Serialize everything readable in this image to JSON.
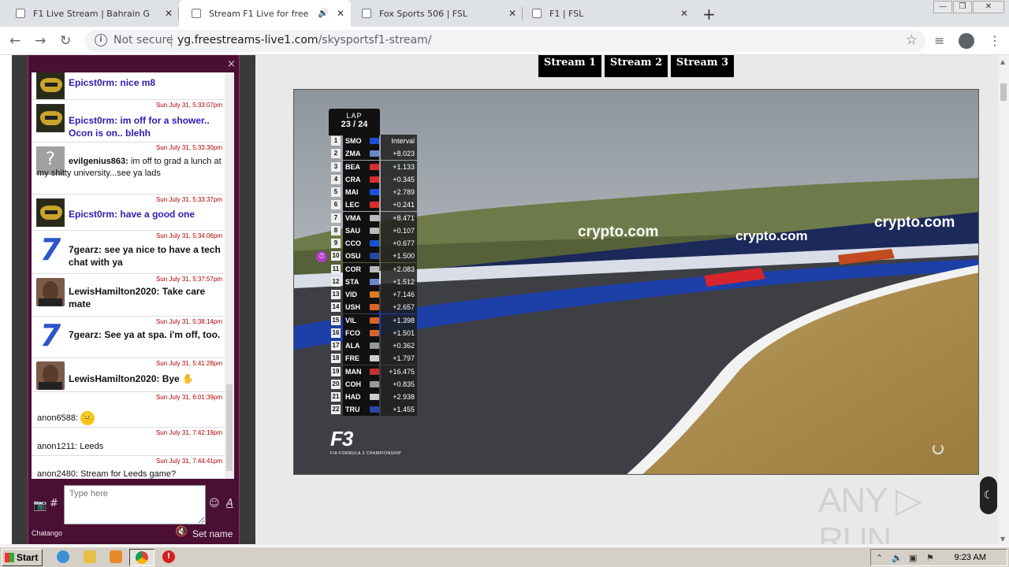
{
  "browser": {
    "tabs": [
      {
        "title": "F1 Live Stream | Bahrain GP Stre",
        "active": false
      },
      {
        "title": "Stream F1 Live for free on",
        "active": true
      },
      {
        "title": "Fox Sports 506 | FSL",
        "active": false
      },
      {
        "title": "F1 | FSL",
        "active": false
      }
    ],
    "tab_close": "✕",
    "new_tab": "+",
    "security": "Not secure",
    "url_host": "yg.freestreams-live1.com",
    "url_path": "/skysportsf1-stream/"
  },
  "chat": {
    "close": "×",
    "messages": [
      {
        "user": "Epicst0rm:",
        "text": "nice m8",
        "time": "",
        "avatar": "helmet"
      },
      {
        "user": "Epicst0rm:",
        "text": "im off for a shower.. Ocon is on.. blehh",
        "time": "Sun July 31, 5:33:07pm",
        "avatar": "helmet"
      },
      {
        "user": "evilgenius863:",
        "text": "im off to grad a lunch at my shitty university...see ya lads",
        "time": "Sun July 31, 5:33:30pm",
        "avatar": "question"
      },
      {
        "user": "Epicst0rm:",
        "text": "have a good one",
        "time": "Sun July 31, 5:33:37pm",
        "avatar": "helmet"
      },
      {
        "user": "7gearz:",
        "text": "see ya nice to have a tech chat with ya",
        "time": "Sun July 31, 5:34:06pm",
        "avatar": "seven"
      },
      {
        "user": "LewisHamilton2020:",
        "text": "Take care mate",
        "time": "Sun July 31, 5:37:57pm",
        "avatar": "lh"
      },
      {
        "user": "7gearz:",
        "text": "See ya at spa. i'm off, too.",
        "time": "Sun July 31, 5:38:14pm",
        "avatar": "seven"
      },
      {
        "user": "LewisHamilton2020:",
        "text": "Bye",
        "time": "Sun July 31, 5:41:28pm",
        "avatar": "lh"
      },
      {
        "user": "anon6588:",
        "text": "",
        "time": "Sun July 31, 6:01:39pm",
        "avatar": ""
      },
      {
        "user": "anon1211:",
        "text": "Leeds",
        "time": "Sun July 31, 7:42:19pm",
        "avatar": ""
      },
      {
        "user": "anon2480:",
        "text": "Stream for Leeds game?",
        "time": "Sun July 31, 7:44:41pm",
        "avatar": ""
      }
    ],
    "input_placeholder": "Type here",
    "hash": "#",
    "brand": "Chatango",
    "set_name": "Set name"
  },
  "streams": [
    "Stream 1",
    "Stream 2",
    "Stream 3"
  ],
  "video": {
    "lap_label": "LAP",
    "lap_value": "23 / 24",
    "interval_label": "Interval",
    "series": "F3",
    "series_sub": "FIA FORMULA 3 CHAMPIONSHIP",
    "banner": "crypto.com",
    "standings": [
      {
        "pos": "1",
        "driver": "SMO",
        "gap": "Interval",
        "team_color": "#1b4fd6"
      },
      {
        "pos": "2",
        "driver": "ZMA",
        "gap": "+8.023",
        "team_color": "#6d86c9"
      },
      {
        "pos": "3",
        "driver": "BEA",
        "gap": "+1.133",
        "team_color": "#d92d2d"
      },
      {
        "pos": "4",
        "driver": "CRA",
        "gap": "+0.345",
        "team_color": "#d92d2d"
      },
      {
        "pos": "5",
        "driver": "MAI",
        "gap": "+2.789",
        "team_color": "#1b4fd6"
      },
      {
        "pos": "6",
        "driver": "LEC",
        "gap": "+0.241",
        "team_color": "#d92d2d"
      },
      {
        "pos": "7",
        "driver": "VMA",
        "gap": "+8.471",
        "team_color": "#bbbbbb"
      },
      {
        "pos": "8",
        "driver": "SAU",
        "gap": "+0.107",
        "team_color": "#bbbbbb"
      },
      {
        "pos": "9",
        "driver": "CCO",
        "gap": "+0.677",
        "team_color": "#1b4fd6"
      },
      {
        "pos": "10",
        "driver": "OSU",
        "gap": "+1.500",
        "team_color": "#2946a8"
      },
      {
        "pos": "11",
        "driver": "COR",
        "gap": "+2.083",
        "team_color": "#bbbbbb"
      },
      {
        "pos": "12",
        "driver": "STA",
        "gap": "+1.512",
        "team_color": "#6d86c9"
      },
      {
        "pos": "13",
        "driver": "VID",
        "gap": "+7.146",
        "team_color": "#e07a22"
      },
      {
        "pos": "14",
        "driver": "USH",
        "gap": "+2.657",
        "team_color": "#d8652c"
      },
      {
        "pos": "15",
        "driver": "VIL",
        "gap": "+1.398",
        "team_color": "#d8652c"
      },
      {
        "pos": "16",
        "driver": "FCO",
        "gap": "+1.501",
        "team_color": "#d8652c"
      },
      {
        "pos": "17",
        "driver": "ALA",
        "gap": "+0.362",
        "team_color": "#999999"
      },
      {
        "pos": "18",
        "driver": "FRE",
        "gap": "+1.797",
        "team_color": "#cccccc"
      },
      {
        "pos": "19",
        "driver": "MAN",
        "gap": "+16.475",
        "team_color": "#c23030"
      },
      {
        "pos": "20",
        "driver": "COH",
        "gap": "+0.835",
        "team_color": "#999999"
      },
      {
        "pos": "21",
        "driver": "HAD",
        "gap": "+2.938",
        "team_color": "#cccccc"
      },
      {
        "pos": "22",
        "driver": "TRU",
        "gap": "+1.455",
        "team_color": "#2946a8"
      }
    ]
  },
  "watermark": "ANY ▷ RUN",
  "taskbar": {
    "start": "Start",
    "clock": "9:23 AM"
  }
}
